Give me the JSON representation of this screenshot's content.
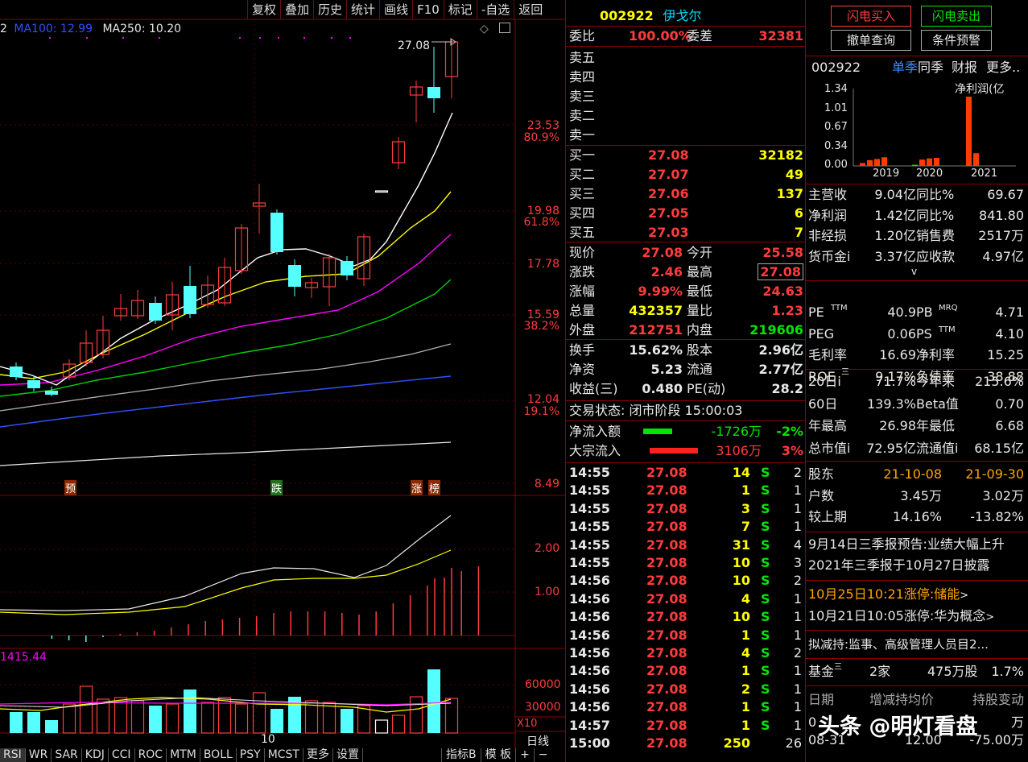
{
  "toolbar": [
    "复权",
    "叠加",
    "历史",
    "统计",
    "画线",
    "F10",
    "标记",
    "-自选",
    "返回"
  ],
  "ma_legend": {
    "ma_a": "2",
    "ma100": "MA100: 12.99",
    "ma250": "MA250: 10.20"
  },
  "price_axis": [
    "23.53",
    "80.9%",
    "19.98",
    "61.8%",
    "17.78",
    "15.59",
    "38.2%",
    "12.04",
    "19.1%",
    "8.49"
  ],
  "peak_label": "27.08",
  "event_marks": [
    "预",
    "跌",
    "涨",
    "榜"
  ],
  "macd_axis": [
    "2.00",
    "1.00"
  ],
  "vol_axis": [
    "60000",
    "30000",
    "X10"
  ],
  "vol_value": "1415.44",
  "date_label": "10",
  "period": "日线",
  "ind_tabs": [
    "RSI",
    "WR",
    "SAR",
    "KDJ",
    "CCI",
    "ROC",
    "MTM",
    "BOLL",
    "PSY",
    "MCST",
    "更多",
    "设置"
  ],
  "ind_right": [
    "指标B",
    "模 板",
    "+",
    "−"
  ],
  "stock": {
    "code": "002922",
    "name": "伊戈尔"
  },
  "weibi": {
    "label": "委比",
    "value": "100.00%",
    "label2": "委差",
    "value2": "32381"
  },
  "sell": [
    {
      "label": "卖五",
      "price": "",
      "vol": ""
    },
    {
      "label": "卖四",
      "price": "",
      "vol": ""
    },
    {
      "label": "卖三",
      "price": "",
      "vol": ""
    },
    {
      "label": "卖二",
      "price": "",
      "vol": ""
    },
    {
      "label": "卖一",
      "price": "",
      "vol": ""
    }
  ],
  "buy": [
    {
      "label": "买一",
      "price": "27.08",
      "vol": "32182"
    },
    {
      "label": "买二",
      "price": "27.07",
      "vol": "49"
    },
    {
      "label": "买三",
      "price": "27.06",
      "vol": "137"
    },
    {
      "label": "买四",
      "price": "27.05",
      "vol": "6"
    },
    {
      "label": "买五",
      "price": "27.03",
      "vol": "7"
    }
  ],
  "stats": [
    {
      "l": "现价",
      "v": "27.08",
      "l2": "今开",
      "v2": "25.58"
    },
    {
      "l": "涨跌",
      "v": "2.46",
      "l2": "最高",
      "v2": "27.08"
    },
    {
      "l": "涨幅",
      "v": "9.99%",
      "l2": "最低",
      "v2": "24.63"
    },
    {
      "l": "总量",
      "v": "432357",
      "l2": "量比",
      "v2": "1.23"
    },
    {
      "l": "外盘",
      "v": "212751",
      "l2": "内盘",
      "v2": "219606"
    }
  ],
  "stats2": [
    {
      "l": "换手",
      "v": "15.62%",
      "l2": "股本",
      "v2": "2.96亿"
    },
    {
      "l": "净资",
      "v": "5.23",
      "l2": "流通",
      "v2": "2.77亿"
    },
    {
      "l": "收益(三)",
      "v": "0.480",
      "l2": "PE(动)",
      "v2": "28.2"
    }
  ],
  "trade_status": "交易状态: 闭市阶段 15:00:03",
  "flow": [
    {
      "l": "净流入额",
      "v": "-1726万",
      "p": "-2%"
    },
    {
      "l": "大宗流入",
      "v": "3106万",
      "p": "3%"
    }
  ],
  "ticks": [
    {
      "t": "14:55",
      "p": "27.08",
      "v": "14",
      "s": "S",
      "n": "2"
    },
    {
      "t": "14:55",
      "p": "27.08",
      "v": "1",
      "s": "S",
      "n": "1"
    },
    {
      "t": "14:55",
      "p": "27.08",
      "v": "3",
      "s": "S",
      "n": "1"
    },
    {
      "t": "14:55",
      "p": "27.08",
      "v": "7",
      "s": "S",
      "n": "1"
    },
    {
      "t": "14:55",
      "p": "27.08",
      "v": "31",
      "s": "S",
      "n": "4"
    },
    {
      "t": "14:55",
      "p": "27.08",
      "v": "10",
      "s": "S",
      "n": "3"
    },
    {
      "t": "14:56",
      "p": "27.08",
      "v": "10",
      "s": "S",
      "n": "2"
    },
    {
      "t": "14:56",
      "p": "27.08",
      "v": "4",
      "s": "S",
      "n": "1"
    },
    {
      "t": "14:56",
      "p": "27.08",
      "v": "10",
      "s": "S",
      "n": "1"
    },
    {
      "t": "14:56",
      "p": "27.08",
      "v": "1",
      "s": "S",
      "n": "1"
    },
    {
      "t": "14:56",
      "p": "27.08",
      "v": "4",
      "s": "S",
      "n": "2"
    },
    {
      "t": "14:56",
      "p": "27.08",
      "v": "1",
      "s": "S",
      "n": "1"
    },
    {
      "t": "14:56",
      "p": "27.08",
      "v": "2",
      "s": "S",
      "n": "1"
    },
    {
      "t": "14:56",
      "p": "27.08",
      "v": "1",
      "s": "S",
      "n": "1"
    },
    {
      "t": "14:57",
      "p": "27.08",
      "v": "1",
      "s": "S",
      "n": "1"
    },
    {
      "t": "15:00",
      "p": "27.08",
      "v": "250",
      "s": "",
      "n": "26"
    }
  ],
  "buttons": {
    "flash_buy": "闪电买入",
    "flash_sell": "闪电卖出",
    "cancel": "撤单查询",
    "alert": "条件预警"
  },
  "fin_tabs": {
    "code": "002922",
    "single": "单季",
    "yoy": "同季",
    "report": "财报",
    "more": "更多.."
  },
  "mini_chart": {
    "axis": [
      "1.34",
      "1.01",
      "0.67",
      "0.34",
      "0.00"
    ],
    "title": "净利润(亿",
    "years": [
      "2019",
      "2020",
      "2021"
    ]
  },
  "chart_data": {
    "type": "bar",
    "title": "净利润(亿",
    "categories": [
      "2019",
      "2020",
      "2021"
    ],
    "series": [
      {
        "values": [
          0.05,
          0.1,
          0.12,
          0.15
        ]
      },
      {
        "values": [
          0.02,
          0.11,
          0.13,
          0.14
        ]
      },
      {
        "values": [
          1.2,
          0.22
        ]
      }
    ],
    "ylim": [
      0,
      1.34
    ]
  },
  "fin": [
    {
      "l": "主营收",
      "v": "9.04亿",
      "l2": "同比%",
      "v2": "69.67"
    },
    {
      "l": "净利润",
      "v": "1.42亿",
      "l2": "同比%",
      "v2": "841.80"
    },
    {
      "l": "非经损",
      "v": "1.20亿",
      "l2": "销售费",
      "v2": "2517万"
    },
    {
      "l": "货币金i",
      "v": "3.37亿",
      "l2": "应收款",
      "v2": "4.97亿"
    }
  ],
  "fin_more": "v",
  "val": [
    {
      "l": "PE",
      "sup": "TTM",
      "v": "40.9",
      "l2": "PB",
      "sup2": "MRQ",
      "v2": "4.71"
    },
    {
      "l": "PEG",
      "sup": "",
      "v": "0.06",
      "l2": "PS",
      "sup2": "TTM",
      "v2": "4.10"
    },
    {
      "l": "毛利率",
      "sup": "",
      "v": "16.69",
      "l2": "净利率",
      "sup2": "",
      "v2": "15.25"
    },
    {
      "l": "ROE",
      "sup": "三",
      "v": "9.17%",
      "l2": "负债率",
      "sup2": "",
      "v2": "38.88"
    }
  ],
  "perf": [
    {
      "l": "20日i",
      "v": "71.7%",
      "l2": "今年来",
      "v2": "215.6%"
    },
    {
      "l": "60日",
      "v": "139.3%",
      "l2": "Beta值",
      "v2": "0.70"
    },
    {
      "l": "年最高",
      "v": "26.98",
      "l2": "年最低",
      "v2": "6.68"
    },
    {
      "l": "总市值i",
      "v": "72.95亿",
      "l2": "流通值i",
      "v2": "68.15亿"
    }
  ],
  "holders": [
    {
      "l": "股东",
      "v": "21-10-08",
      "v2": "21-09-30"
    },
    {
      "l": "户数",
      "v": "3.45万",
      "v2": "3.02万"
    },
    {
      "l": "较上期",
      "v": "14.16%",
      "v2": "-13.82%"
    }
  ],
  "news": [
    "9月14日三季报预告:业绩大幅上升",
    "2021年三季报于10月27日披露"
  ],
  "limit_up": [
    {
      "date": "10月25日10:21涨停:",
      "topic": "储能",
      "arrow": ">"
    },
    {
      "date": "10月21日10:05涨停:",
      "topic": "华为概念",
      "arrow": ">"
    }
  ],
  "reduce": "拟减持:监事、高级管理人员目2...",
  "fund": {
    "l": "基金",
    "sup": "三",
    "count": "2家",
    "shares": "475万股",
    "pct": "1.7%"
  },
  "holder_hdr": {
    "date": "日期",
    "avg": "增减持均价",
    "chg": "持股变动"
  },
  "holder_rows": [
    {
      "date": "0",
      "avg": "",
      "chg": "万"
    },
    {
      "date": "08-31",
      "avg": "12.00",
      "chg": "-75.00万"
    }
  ],
  "watermark": "头条 @明灯看盘"
}
